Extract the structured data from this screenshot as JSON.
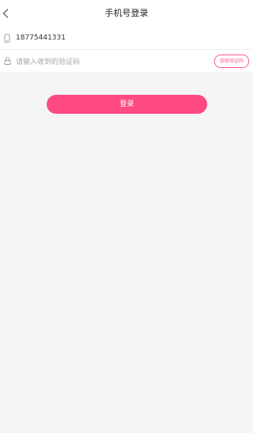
{
  "header": {
    "title": "手机号登录",
    "back_icon": "chevron-left-icon"
  },
  "form": {
    "phone": {
      "icon": "phone-icon",
      "value": "18775441331"
    },
    "code": {
      "icon": "lock-icon",
      "placeholder": "请输入收到的验证码",
      "get_code_label": "获取验证码"
    }
  },
  "login_button_label": "登录",
  "colors": {
    "accent": "#ff4a83",
    "background": "#f5f5f7"
  }
}
